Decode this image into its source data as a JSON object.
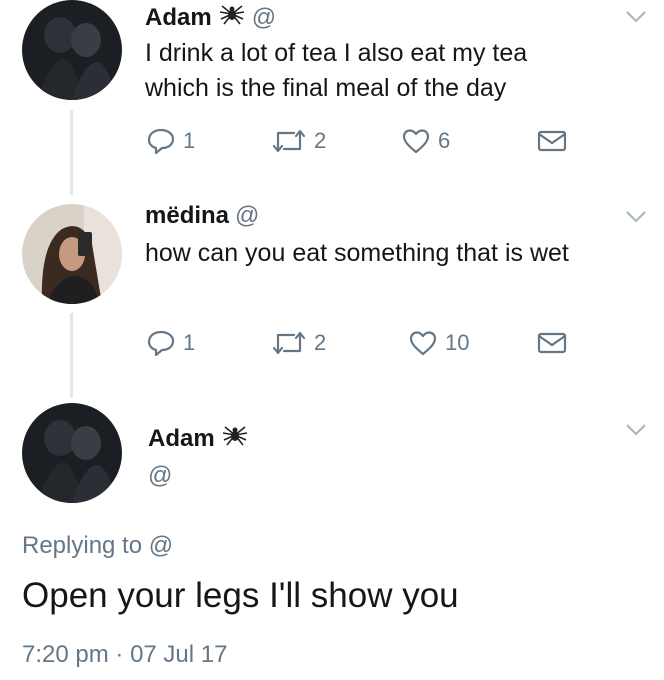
{
  "tweets": [
    {
      "name": "Adam",
      "handle": "@",
      "text_lines": [
        "I drink a lot of tea I also eat my tea",
        "which is the final meal of the day"
      ],
      "replies": "1",
      "retweets": "2",
      "likes": "6"
    },
    {
      "name": "mëdina",
      "handle": "@",
      "text_lines": [
        "how can you eat something that is wet"
      ],
      "replies": "1",
      "retweets": "2",
      "likes": "10"
    }
  ],
  "focused": {
    "name": "Adam",
    "handle": "@",
    "replying_prefix": "Replying to",
    "replying_handle": "@",
    "text": "Open your legs I'll show you",
    "time": "7:20 pm",
    "separator": "·",
    "date": "07 Jul 17"
  },
  "icons": {
    "name_emoji": "spider-icon",
    "reply": "reply-icon",
    "retweet": "retweet-icon",
    "like": "heart-icon",
    "dm": "envelope-icon",
    "menu": "chevron-down-icon"
  },
  "colors": {
    "text": "#14171a",
    "secondary": "#657786",
    "thread_line": "#e1e8ed"
  }
}
